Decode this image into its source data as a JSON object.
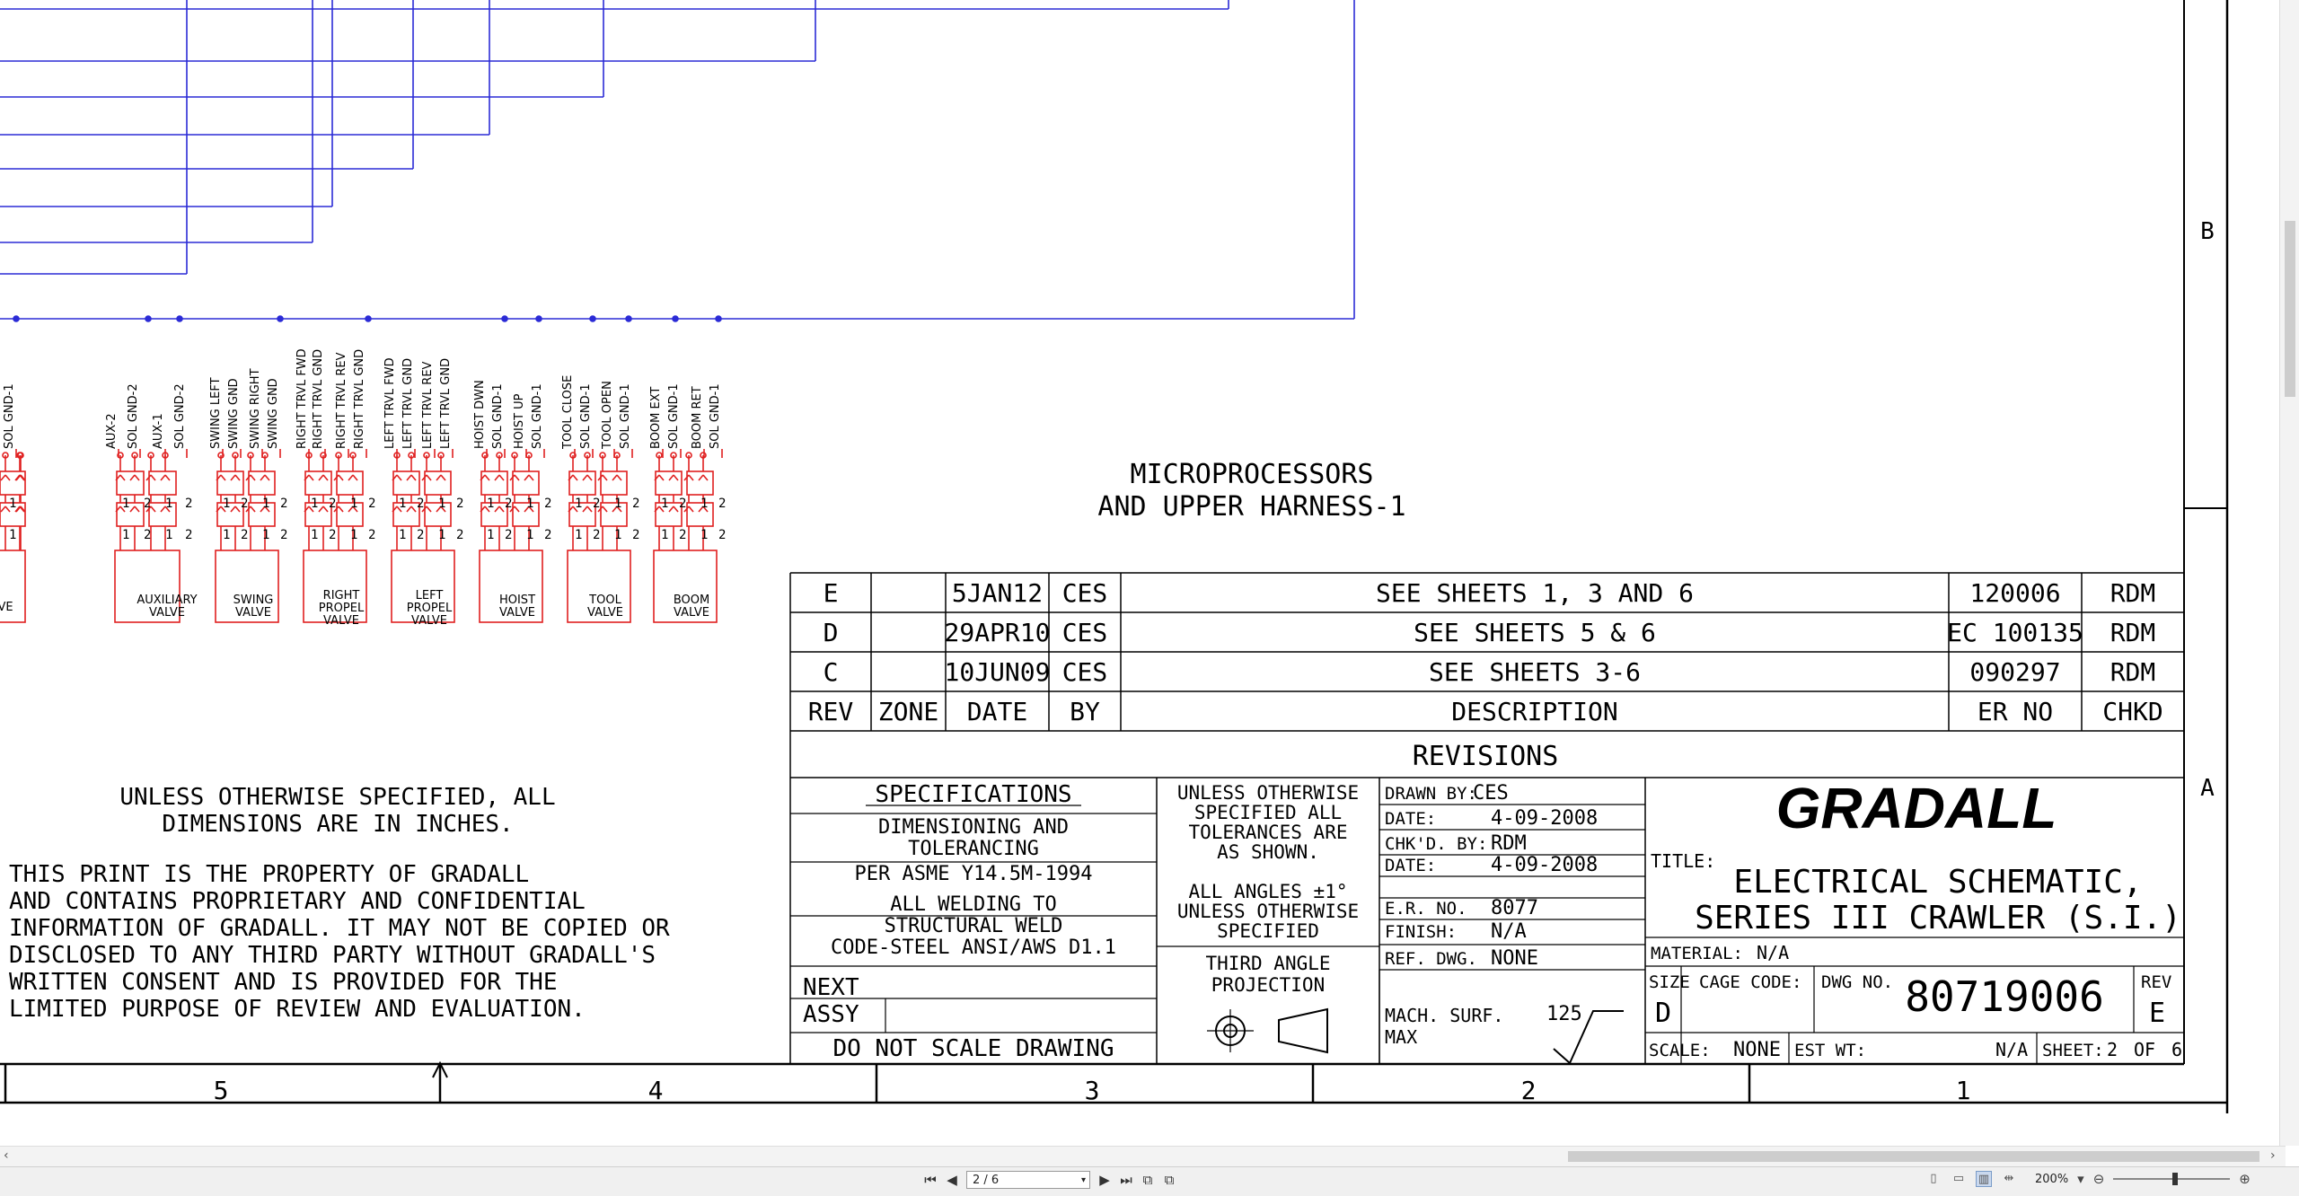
{
  "sheet_title": [
    "MICROPROCESSORS",
    "AND UPPER HARNESS-1"
  ],
  "wires": [
    {
      "labels": [
        "SOL GND-1"
      ]
    },
    {
      "labels": [
        "AUX-2",
        "SOL GND-2"
      ]
    },
    {
      "labels": [
        "AUX-1",
        "SOL GND-2"
      ]
    },
    {
      "labels": [
        "SWING LEFT",
        "SWING GND"
      ]
    },
    {
      "labels": [
        "SWING RIGHT",
        "SWING GND"
      ]
    },
    {
      "labels": [
        "RIGHT TRVL FWD",
        "RIGHT TRVL GND"
      ]
    },
    {
      "labels": [
        "RIGHT TRVL REV",
        "RIGHT TRVL GND"
      ]
    },
    {
      "labels": [
        "LEFT TRVL FWD",
        "LEFT TRVL GND"
      ]
    },
    {
      "labels": [
        "LEFT TRVL REV",
        "LEFT TRVL GND"
      ]
    },
    {
      "labels": [
        "HOIST DWN",
        "SOL GND-1"
      ]
    },
    {
      "labels": [
        "HOIST UP",
        "SOL GND-1"
      ]
    },
    {
      "labels": [
        "TOOL CLOSE",
        "SOL GND-1"
      ]
    },
    {
      "labels": [
        "TOOL OPEN",
        "SOL GND-1"
      ]
    },
    {
      "labels": [
        "BOOM EXT",
        "SOL GND-1"
      ]
    },
    {
      "labels": [
        "BOOM RET",
        "SOL GND-1"
      ]
    }
  ],
  "valves": [
    {
      "lines": [
        "VE"
      ]
    },
    {
      "lines": [
        "AUXILIARY",
        "VALVE"
      ]
    },
    {
      "lines": [
        "SWING",
        "VALVE"
      ]
    },
    {
      "lines": [
        "RIGHT",
        "PROPEL",
        "VALVE"
      ]
    },
    {
      "lines": [
        "LEFT",
        "PROPEL",
        "VALVE"
      ]
    },
    {
      "lines": [
        "HOIST",
        "VALVE"
      ]
    },
    {
      "lines": [
        "TOOL",
        "VALVE"
      ]
    },
    {
      "lines": [
        "BOOM",
        "VALVE"
      ]
    }
  ],
  "pin_labels": [
    "1",
    "2"
  ],
  "revisions": {
    "rows": [
      {
        "rev": "E",
        "zone": "",
        "date": "5JAN12",
        "by": "CES",
        "description": "SEE SHEETS 1, 3 AND 6",
        "er_no": "120006",
        "chkd": "RDM"
      },
      {
        "rev": "D",
        "zone": "",
        "date": "29APR10",
        "by": "CES",
        "description": "SEE SHEETS 5 & 6",
        "er_no": "EC 100135",
        "chkd": "RDM"
      },
      {
        "rev": "C",
        "zone": "",
        "date": "10JUN09",
        "by": "CES",
        "description": "SEE SHEETS 3-6",
        "er_no": "090297",
        "chkd": "RDM"
      }
    ],
    "headers": {
      "rev": "REV",
      "zone": "ZONE",
      "date": "DATE",
      "by": "BY",
      "description": "DESCRIPTION",
      "er_no": "ER NO",
      "chkd": "CHKD"
    },
    "title": "REVISIONS"
  },
  "notes": {
    "dimensions": [
      "UNLESS OTHERWISE SPECIFIED, ALL",
      "DIMENSIONS ARE IN INCHES."
    ],
    "property": [
      "THIS PRINT IS THE PROPERTY OF GRADALL",
      "AND CONTAINS PROPRIETARY AND CONFIDENTIAL",
      "INFORMATION OF GRADALL. IT MAY NOT BE COPIED OR",
      "DISCLOSED TO ANY THIRD PARTY WITHOUT GRADALL'S",
      "WRITTEN CONSENT AND IS PROVIDED FOR THE",
      "LIMITED PURPOSE OF REVIEW AND EVALUATION."
    ]
  },
  "specifications": {
    "title": "SPECIFICATIONS",
    "dim_tol": [
      "DIMENSIONING AND",
      "TOLERANCING"
    ],
    "asme": "PER ASME Y14.5M-1994",
    "welding": [
      "ALL WELDING TO",
      "STRUCTURAL WELD",
      "CODE-STEEL ANSI/AWS D1.1"
    ],
    "next_assy": [
      "NEXT",
      "ASSY"
    ],
    "do_not_scale": "DO NOT SCALE DRAWING"
  },
  "tolerances": {
    "text": [
      "UNLESS OTHERWISE",
      "SPECIFIED ALL",
      "TOLERANCES ARE",
      "AS SHOWN."
    ],
    "angles": [
      "ALL ANGLES ±1°",
      "UNLESS OTHERWISE",
      "SPECIFIED"
    ],
    "projection": [
      "THIRD ANGLE",
      "PROJECTION"
    ]
  },
  "title_block": {
    "drawn_by_label": "DRAWN BY:",
    "drawn_by": "CES",
    "date1_label": "DATE:",
    "date1": "4-09-2008",
    "chkd_by_label": "CHK'D. BY:",
    "chkd_by": "RDM",
    "date2_label": "DATE:",
    "date2": "4-09-2008",
    "er_no_label": "E.R. NO.",
    "er_no": "8077",
    "finish_label": "FINISH:",
    "finish": "N/A",
    "ref_dwg_label": "REF. DWG.",
    "ref_dwg": "NONE",
    "mach_surf_label": [
      "MACH. SURF.",
      "MAX"
    ],
    "mach_surf": "125",
    "company": "GRADALL",
    "title_label": "TITLE:",
    "title": [
      "ELECTRICAL SCHEMATIC,",
      "SERIES III CRAWLER (S.I.)"
    ],
    "material_label": "MATERIAL:",
    "material": "N/A",
    "size_label": "SIZE",
    "size": "D",
    "cage_code_label": "CAGE CODE:",
    "dwg_no_label": "DWG NO.",
    "dwg_no": "80719006",
    "rev_label": "REV",
    "rev": "E",
    "scale_label": "SCALE:",
    "scale": "NONE",
    "est_wt_label": "EST WT:",
    "est_wt": "N/A",
    "sheet_label": "SHEET:",
    "sheet": "2",
    "of_label": "OF",
    "sheet_total": "6"
  },
  "zones_bottom": [
    "5",
    "4",
    "3",
    "2",
    "1"
  ],
  "zones_right": [
    "B",
    "A"
  ],
  "viewer": {
    "page_field": "2 / 6",
    "zoom": "200%",
    "colors": {
      "wire": "#2b2bd6",
      "component": "#e02020",
      "ink": "#000000"
    }
  }
}
